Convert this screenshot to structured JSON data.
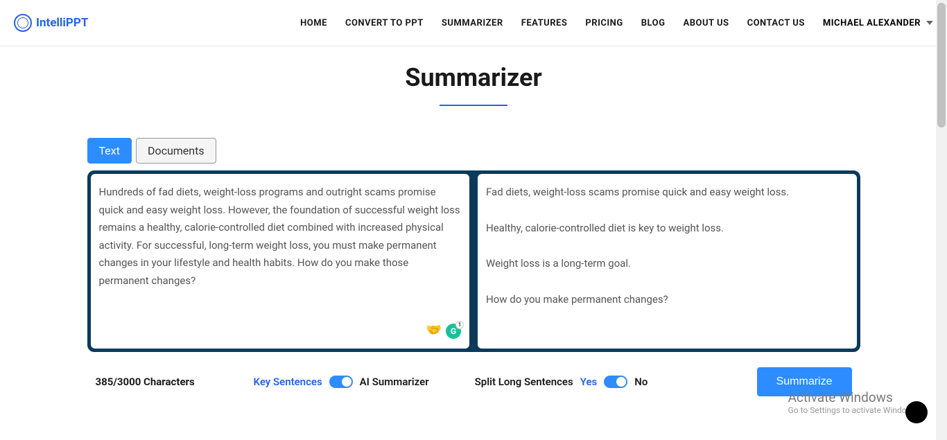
{
  "brand": "IntelliPPT",
  "nav": {
    "items": [
      "HOME",
      "CONVERT TO PPT",
      "SUMMARIZER",
      "FEATURES",
      "PRICING",
      "BLOG",
      "ABOUT US",
      "CONTACT US"
    ],
    "user": "MICHAEL ALEXANDER"
  },
  "page": {
    "title": "Summarizer"
  },
  "tabs": {
    "text": "Text",
    "documents": "Documents"
  },
  "input": {
    "text": "Hundreds of fad diets, weight-loss programs and outright scams promise quick and easy weight loss. However, the foundation of successful weight loss remains a healthy, calorie-controlled diet combined with increased physical activity. For successful, long-term weight loss, you must make permanent changes in your lifestyle and health habits. How do you make those permanent changes?",
    "grammar_badge": "1"
  },
  "output": {
    "line1": "Fad diets, weight-loss scams promise quick and easy weight loss.",
    "line2": "Healthy, calorie-controlled diet is key to weight loss.",
    "line3": "Weight loss is a long-term goal.",
    "line4": "How do you make permanent changes?"
  },
  "controls": {
    "char_count": "385/3000 Characters",
    "key_sentences": "Key Sentences",
    "ai_summarizer": "AI Summarizer",
    "split_long": "Split Long Sentences",
    "yes": "Yes",
    "no": "No",
    "summarize": "Summarize"
  },
  "overlay": {
    "activate_title": "Activate Windows",
    "activate_sub": "Go to Settings to activate Windows."
  }
}
